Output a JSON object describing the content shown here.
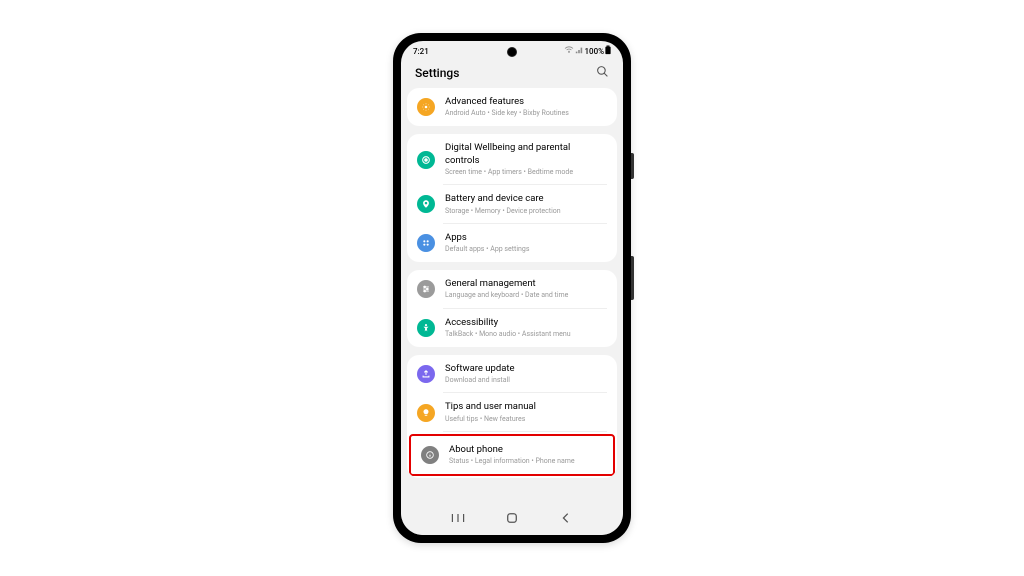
{
  "status": {
    "time": "7:21",
    "battery_pct": "100%"
  },
  "header": {
    "title": "Settings"
  },
  "groups": [
    [
      {
        "title": "Advanced features",
        "subtitle": "Android Auto  •  Side key  •  Bixby Routines",
        "icon": "adv"
      }
    ],
    [
      {
        "title": "Digital Wellbeing and parental controls",
        "subtitle": "Screen time  •  App timers  •  Bedtime mode",
        "icon": "well"
      },
      {
        "title": "Battery and device care",
        "subtitle": "Storage  •  Memory  •  Device protection",
        "icon": "batt"
      },
      {
        "title": "Apps",
        "subtitle": "Default apps  •  App settings",
        "icon": "apps"
      }
    ],
    [
      {
        "title": "General management",
        "subtitle": "Language and keyboard  •  Date and time",
        "icon": "gen"
      },
      {
        "title": "Accessibility",
        "subtitle": "TalkBack  •  Mono audio  •  Assistant menu",
        "icon": "acc"
      }
    ],
    [
      {
        "title": "Software update",
        "subtitle": "Download and install",
        "icon": "soft"
      },
      {
        "title": "Tips and user manual",
        "subtitle": "Useful tips  •  New features",
        "icon": "tips"
      },
      {
        "title": "About phone",
        "subtitle": "Status  •  Legal information  •  Phone name",
        "icon": "about",
        "highlight": true
      }
    ]
  ]
}
